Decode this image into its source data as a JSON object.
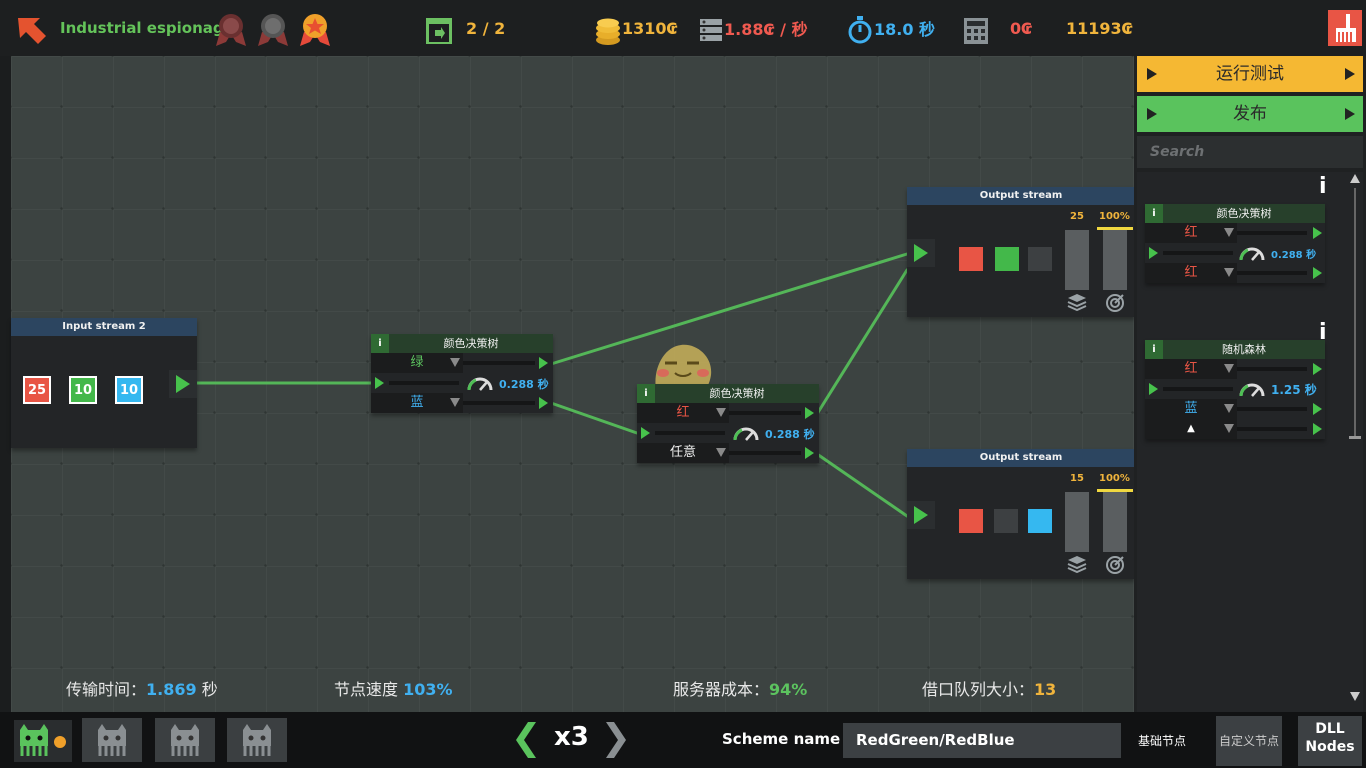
{
  "header": {
    "level_title": "Industrial espionage",
    "medals": [
      "bronze-medal-icon",
      "silver-medal-icon",
      "gold-medal-icon"
    ],
    "counter": "2 / 2",
    "coins": "1310₢",
    "rate": "1.88₢ / 秒",
    "timer": "18.0 秒",
    "cost": "0₢",
    "total": "11193₢"
  },
  "board": {
    "input_stream": {
      "title": "Input stream 2",
      "values": [
        "25",
        "10",
        "10"
      ],
      "colors": [
        "#e85545",
        "#43b84a",
        "#35b8f0"
      ]
    },
    "node1": {
      "info": "i",
      "title": "颜色决策树",
      "select_top": "绿",
      "select_bottom": "蓝",
      "speed": "0.288 秒"
    },
    "node2": {
      "info": "i",
      "title": "颜色决策树",
      "select_top": "红",
      "select_bottom": "任意",
      "speed": "0.288 秒"
    },
    "output1": {
      "title": "Output stream",
      "count": "25",
      "percent": "100%",
      "squares": [
        "#e85545",
        "#43b84a",
        "#3d4042"
      ]
    },
    "output2": {
      "title": "Output stream",
      "count": "15",
      "percent": "100%",
      "squares": [
        "#e85545",
        "#3d4042",
        "#35b8f0"
      ]
    }
  },
  "stats": {
    "transfer_label": "传输时间：",
    "transfer_value": "1.869",
    "transfer_unit": " 秒",
    "node_speed_label": "节点速度 ",
    "node_speed_value": "103%",
    "server_cost_label": "服务器成本：",
    "server_cost_value": "94%",
    "queue_label": "借口队列大小：",
    "queue_value": "13"
  },
  "panel": {
    "run_test": "运行测试",
    "publish": "发布",
    "search_placeholder": "Search",
    "run_color": "#f5b833",
    "publish_color": "#5ac35d",
    "items": [
      {
        "info": "i",
        "title": "颜色决策树",
        "select_top": "红",
        "select_bottom": "红",
        "speed": "0.288 秒"
      },
      {
        "info": "i",
        "title": "随机森林",
        "select_1": "红",
        "select_2": "蓝",
        "select_3": "▲",
        "speed": "1.25 秒"
      }
    ]
  },
  "bottom": {
    "speed_multiplier": "x3",
    "scheme_label": "Scheme name :",
    "scheme_value": "RedGreen/RedBlue",
    "tab_basic": "基础节点",
    "tab_custom": "自定义节点",
    "tab_dll_line1": "DLL",
    "tab_dll_line2": "Nodes"
  }
}
